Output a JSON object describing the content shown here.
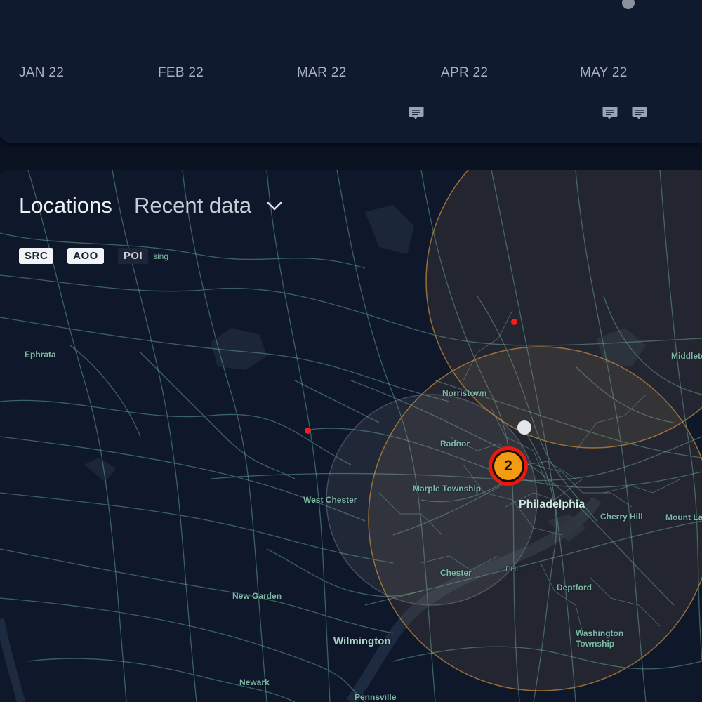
{
  "timeline": {
    "months": [
      "JAN 22",
      "FEB 22",
      "MAR 22",
      "APR 22",
      "MAY 22"
    ]
  },
  "locations": {
    "title": "Locations",
    "view_select": {
      "selected": "Recent data"
    },
    "layer_toggles": [
      {
        "label": "SRC",
        "active": true
      },
      {
        "label": "AOO",
        "active": true
      },
      {
        "label": "POI",
        "active": false
      }
    ]
  },
  "map": {
    "places": [
      "Ephrata",
      "Middletown Township",
      "Norristown",
      "Radnor",
      "Marple Township",
      "West Chester",
      "Philadelphia",
      "Cherry Hill",
      "Mount Laurel",
      "Chester",
      "PHL",
      "Deptford",
      "New Garden",
      "Wilmington",
      "Washington Township",
      "Newark",
      "Pennsville",
      "sing"
    ],
    "cluster": {
      "count": "2"
    },
    "colors": {
      "background": "#0f182b",
      "roads": "#5e9e94",
      "aoo_fill": "#f5a623",
      "cluster_fill": "#f39c12",
      "cluster_ring": "#e8190f",
      "source_marker": "#ff1a1a"
    },
    "icons": [
      "comment-icon",
      "chevron-down-icon"
    ]
  }
}
